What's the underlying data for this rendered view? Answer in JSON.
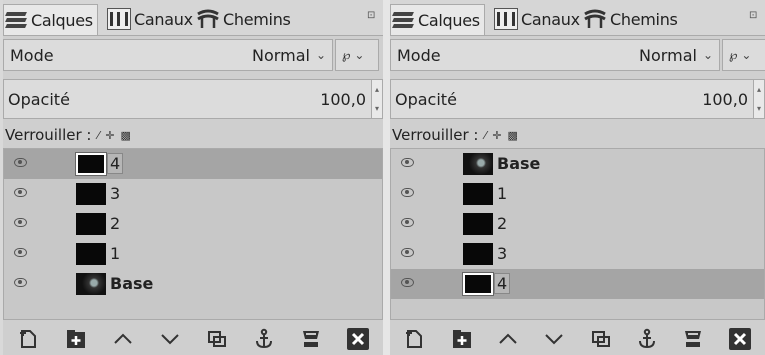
{
  "panels": [
    {
      "tabs": [
        "Calques",
        "Canaux",
        "Chemins"
      ],
      "mode_label": "Mode",
      "mode_value": "Normal",
      "opacity_label": "Opacité",
      "opacity_value": "100,0",
      "lock_label": "Verrouiller :",
      "layers": [
        {
          "name": "4",
          "visible": true,
          "selected": true,
          "bold": false,
          "thumb": "black"
        },
        {
          "name": "3",
          "visible": true,
          "selected": false,
          "bold": false,
          "thumb": "black"
        },
        {
          "name": "2",
          "visible": true,
          "selected": false,
          "bold": false,
          "thumb": "black"
        },
        {
          "name": "1",
          "visible": true,
          "selected": false,
          "bold": false,
          "thumb": "black"
        },
        {
          "name": "Base",
          "visible": true,
          "selected": false,
          "bold": true,
          "thumb": "photo"
        }
      ]
    },
    {
      "tabs": [
        "Calques",
        "Canaux",
        "Chemins"
      ],
      "mode_label": "Mode",
      "mode_value": "Normal",
      "opacity_label": "Opacité",
      "opacity_value": "100,0",
      "lock_label": "Verrouiller :",
      "layers": [
        {
          "name": "Base",
          "visible": true,
          "selected": false,
          "bold": true,
          "thumb": "photo"
        },
        {
          "name": "1",
          "visible": true,
          "selected": false,
          "bold": false,
          "thumb": "black"
        },
        {
          "name": "2",
          "visible": true,
          "selected": false,
          "bold": false,
          "thumb": "black"
        },
        {
          "name": "3",
          "visible": true,
          "selected": false,
          "bold": false,
          "thumb": "black"
        },
        {
          "name": "4",
          "visible": true,
          "selected": true,
          "bold": false,
          "thumb": "black"
        }
      ]
    }
  ],
  "toolbar_icons": [
    "new-layer-icon",
    "new-group-icon",
    "raise-icon",
    "lower-icon",
    "duplicate-icon",
    "anchor-icon",
    "merge-down-icon",
    "delete-icon"
  ]
}
